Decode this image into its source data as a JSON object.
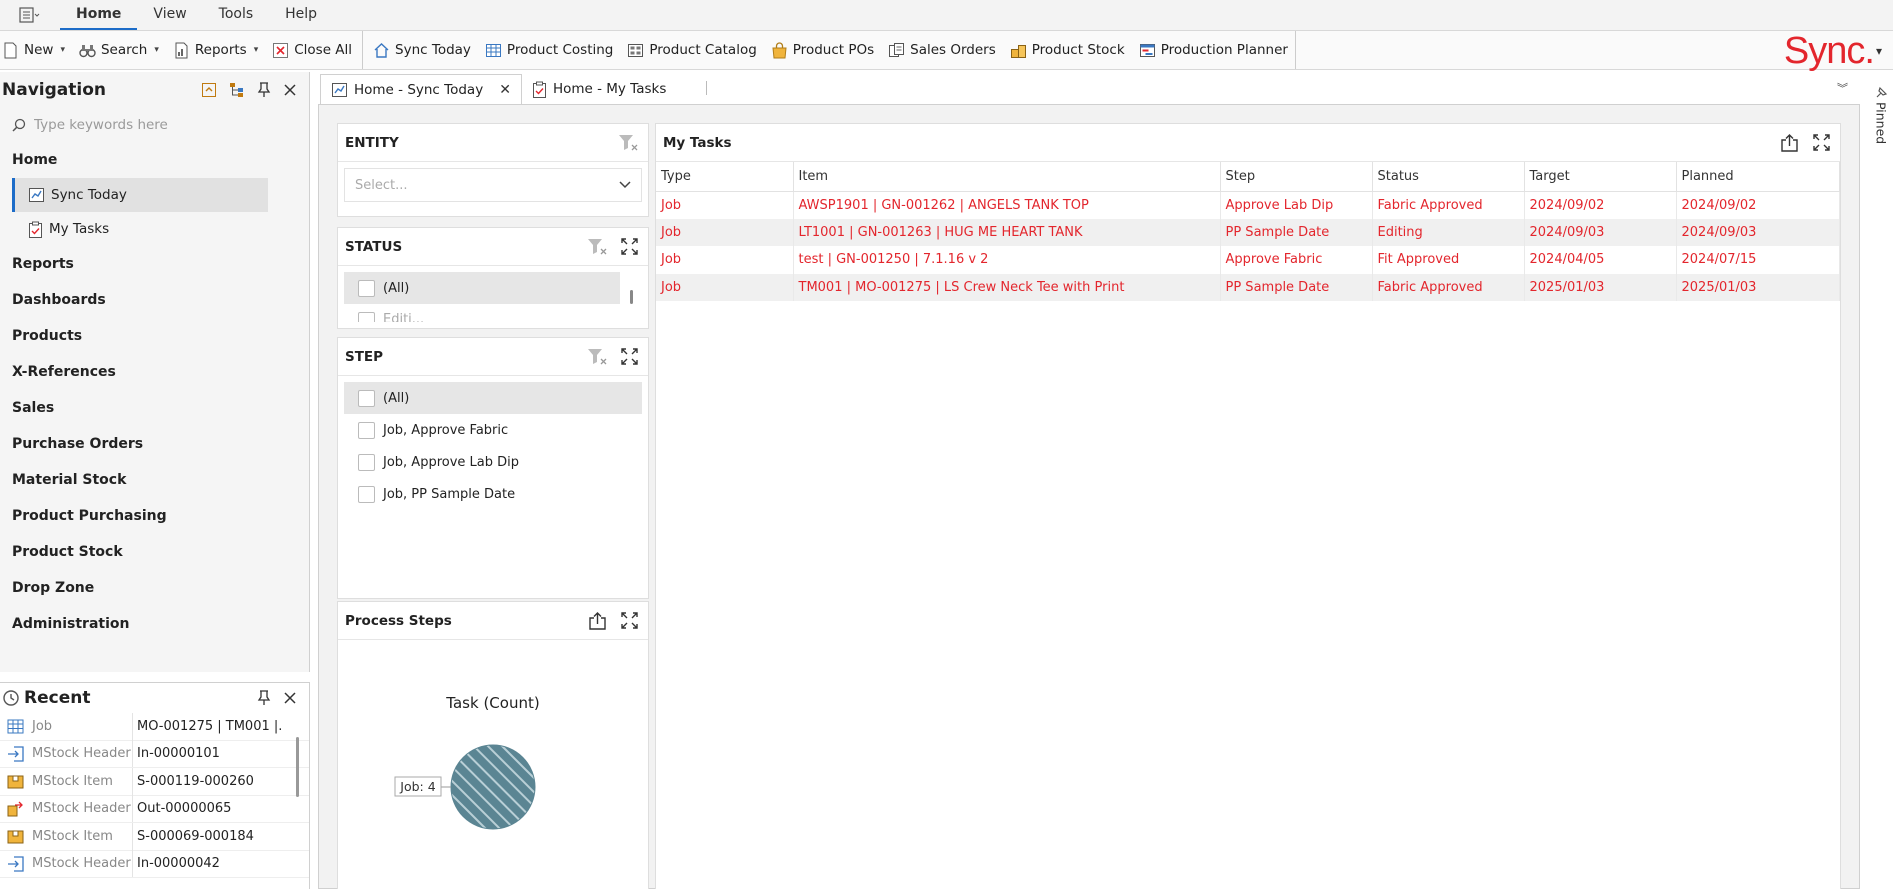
{
  "menubar": {
    "items": [
      {
        "label": "Home",
        "active": true
      },
      {
        "label": "View"
      },
      {
        "label": "Tools"
      },
      {
        "label": "Help"
      }
    ]
  },
  "toolbar": {
    "new": "New",
    "search": "Search",
    "reports": "Reports",
    "close_all": "Close All",
    "sync_today": "Sync Today",
    "product_costing": "Product Costing",
    "product_catalog": "Product Catalog",
    "product_pos": "Product POs",
    "sales_orders": "Sales Orders",
    "product_stock": "Product Stock",
    "production_planner": "Production Planner",
    "logo": "Sync."
  },
  "navigation": {
    "title": "Navigation",
    "search_placeholder": "Type keywords here",
    "home": "Home",
    "home_items": [
      {
        "label": "Sync Today",
        "selected": true
      },
      {
        "label": "My Tasks"
      }
    ],
    "sections": [
      "Reports",
      "Dashboards",
      "Products",
      "X-References",
      "Sales",
      "Purchase Orders",
      "Material Stock",
      "Product Purchasing",
      "Product Stock",
      "Drop Zone",
      "Administration"
    ]
  },
  "recent": {
    "title": "Recent",
    "rows": [
      {
        "type": "Job",
        "value": "MO-001275 | TM001 |...",
        "icon": "grid-icon"
      },
      {
        "type": "MStock Header",
        "value": "In-00000101",
        "icon": "stock-in-icon"
      },
      {
        "type": "MStock Item",
        "value": "S-000119-000260",
        "icon": "box-icon"
      },
      {
        "type": "MStock Header",
        "value": "Out-00000065",
        "icon": "stock-out-icon"
      },
      {
        "type": "MStock Item",
        "value": "S-000069-000184",
        "icon": "box-icon"
      },
      {
        "type": "MStock Header",
        "value": "In-00000042",
        "icon": "stock-in-icon"
      }
    ]
  },
  "tabs": [
    {
      "label": "Home - Sync Today",
      "active": true
    },
    {
      "label": "Home - My Tasks"
    }
  ],
  "filters": {
    "entity": {
      "title": "ENTITY",
      "placeholder": "Select..."
    },
    "status": {
      "title": "STATUS",
      "items": [
        "(All)",
        "Editi..."
      ]
    },
    "step": {
      "title": "STEP",
      "items": [
        "(All)",
        "Job, Approve Fabric",
        "Job, Approve Lab Dip",
        "Job, PP Sample Date"
      ]
    }
  },
  "process_steps": {
    "title": "Process Steps"
  },
  "chart_data": {
    "type": "pie",
    "title": "Task (Count)",
    "slices": [
      {
        "label": "Job",
        "value": 4
      }
    ],
    "data_label": "Job: 4",
    "colors": {
      "slice": "#5b8593",
      "hatch": "#b9cfd6"
    }
  },
  "my_tasks": {
    "title": "My Tasks",
    "columns": [
      "Type",
      "Item",
      "Step",
      "Status",
      "Target",
      "Planned"
    ],
    "rows": [
      [
        "Job",
        "AWSP1901 | GN-001262 | ANGELS TANK TOP",
        "Approve Lab Dip",
        "Fabric Approved",
        "2024/09/02",
        "2024/09/02"
      ],
      [
        "Job",
        "LT1001 | GN-001263 | HUG ME HEART TANK",
        "PP Sample Date",
        "Editing",
        "2024/09/03",
        "2024/09/03"
      ],
      [
        "Job",
        "test | GN-001250 | 7.1.16 v 2",
        "Approve Fabric",
        "Fit Approved",
        "2024/04/05",
        "2024/07/15"
      ],
      [
        "Job",
        "TM001 | MO-001275 | LS Crew Neck Tee with Print",
        "PP Sample Date",
        "Fabric Approved",
        "2025/01/03",
        "2025/01/03"
      ]
    ]
  },
  "pinned_label": "Pinned",
  "colors": {
    "accent": "#1c6cc8",
    "brand": "#e3262d",
    "task_text": "#e3262d"
  }
}
